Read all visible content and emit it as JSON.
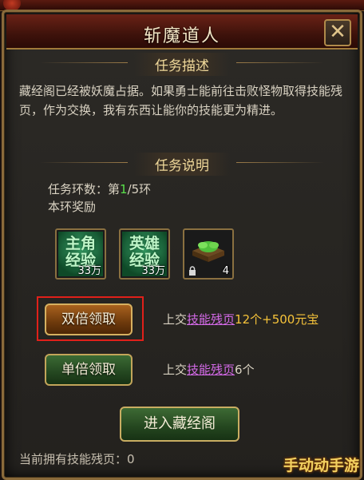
{
  "window": {
    "title": "斩魔道人",
    "close_symbol": "✕"
  },
  "task_desc": {
    "heading": "任务描述",
    "text": "藏经阁已经被妖魔占据。如果勇士能前往击败怪物取得技能残页，作为交换，我有东西让能你的技能更为精进。"
  },
  "task_info": {
    "heading": "任务说明",
    "ring_label": "任务环数：第",
    "ring_current": "1",
    "ring_total": "/5环",
    "reward_label": "本环奖励"
  },
  "rewards": [
    {
      "icon": "hero-exp-scroll-icon",
      "text": "主角经验",
      "count": "33万"
    },
    {
      "icon": "hero-exp-scroll-icon",
      "text": "英雄经验",
      "count": "33万"
    },
    {
      "icon": "skill-book-icon",
      "count": "4",
      "locked": true
    }
  ],
  "actions": {
    "double_claim": {
      "label": "双倍领取",
      "prefix": "上交",
      "link": "技能残页",
      "cost": "12个+",
      "gold": "500元宝"
    },
    "single_claim": {
      "label": "单倍领取",
      "prefix": "上交",
      "link": "技能残页",
      "cost": "6个"
    },
    "enter": {
      "label": "进入藏经阁"
    }
  },
  "footer": {
    "text": "当前拥有技能残页：0"
  },
  "watermark": "手动动手游",
  "colors": {
    "highlight": "#e0201a",
    "link": "#d46ae8",
    "gold": "#f6c33a",
    "ring_current": "#59e04a"
  }
}
